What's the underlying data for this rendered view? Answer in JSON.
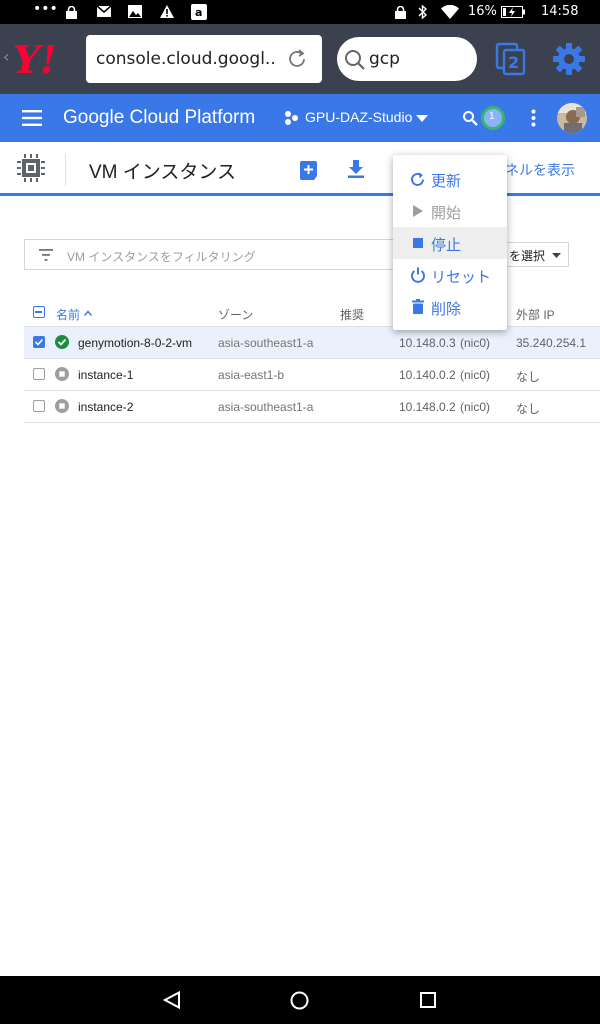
{
  "status_bar": {
    "battery_percent": "16%",
    "time": "14:58"
  },
  "browser": {
    "url": "console.cloud.googl...",
    "search_query": "gcp",
    "tab_count": "2",
    "brand_color": "#ff0033"
  },
  "gcp_header": {
    "title": "Google Cloud Platform",
    "project": "GPU-DAZ-Studio",
    "notification_count": "1",
    "bar_color": "#3b78e7"
  },
  "page": {
    "title": "VM インスタンス",
    "panel_link": "ネルを表示",
    "filter_placeholder": "VM インスタンスをフィルタリング",
    "column_select": "を選択"
  },
  "table": {
    "headers": {
      "name": "名前",
      "zone": "ゾーン",
      "recommendation": "推奨",
      "external_ip": "外部 IP"
    },
    "rows": [
      {
        "name": "genymotion-8-0-2-vm",
        "zone": "asia-southeast1-a",
        "internal_ip": "10.148.0.3",
        "nic": "(nic0)",
        "external_ip": "35.240.254.1",
        "status": "running",
        "checked": true
      },
      {
        "name": "instance-1",
        "zone": "asia-east1-b",
        "internal_ip": "10.140.0.2",
        "nic": "(nic0)",
        "external_ip": "なし",
        "status": "stopped",
        "checked": false
      },
      {
        "name": "instance-2",
        "zone": "asia-southeast1-a",
        "internal_ip": "10.148.0.2",
        "nic": "(nic0)",
        "external_ip": "なし",
        "status": "stopped",
        "checked": false
      }
    ]
  },
  "menu": {
    "items": [
      {
        "label": "更新",
        "icon": "refresh-icon",
        "enabled": true
      },
      {
        "label": "開始",
        "icon": "play-icon",
        "enabled": false
      },
      {
        "label": "停止",
        "icon": "stop-icon",
        "enabled": true
      },
      {
        "label": "リセット",
        "icon": "power-icon",
        "enabled": true
      },
      {
        "label": "削除",
        "icon": "trash-icon",
        "enabled": true
      }
    ]
  }
}
